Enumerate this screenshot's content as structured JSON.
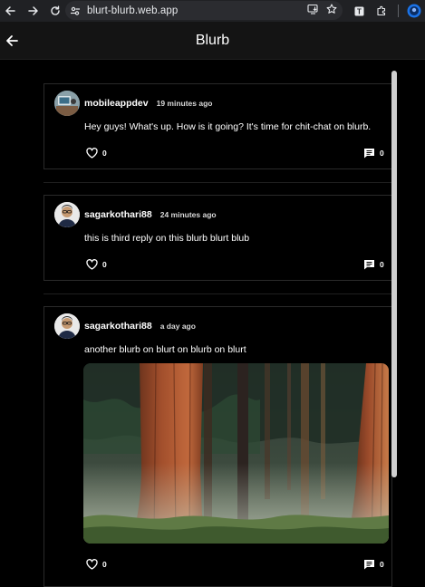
{
  "browser": {
    "url": "blurt-blurb.web.app",
    "back_icon": "arrow-left-icon",
    "forward_icon": "arrow-right-icon",
    "reload_icon": "reload-icon"
  },
  "header": {
    "title": "Blurb",
    "back_icon": "arrow-left-icon"
  },
  "posts": [
    {
      "username": "mobileappdev",
      "time": "19 minutes ago",
      "text": "Hey guys! What's up. How is it going? It's time for chit-chat on blurb.",
      "likes": "0",
      "comments": "0"
    },
    {
      "username": "sagarkothari88",
      "time": "24 minutes ago",
      "text": "this is third reply on this blurb blurt blub",
      "likes": "0",
      "comments": "0"
    },
    {
      "username": "sagarkothari88",
      "time": "a day ago",
      "text": "another blurb on blurt on blurb on blurt",
      "likes": "0",
      "comments": "0",
      "image": "forest-redwood-trees-image"
    }
  ],
  "colors": {
    "background": "#000000",
    "header": "#141414",
    "card_border": "#2a2a2a",
    "browser_bar": "#202124"
  }
}
